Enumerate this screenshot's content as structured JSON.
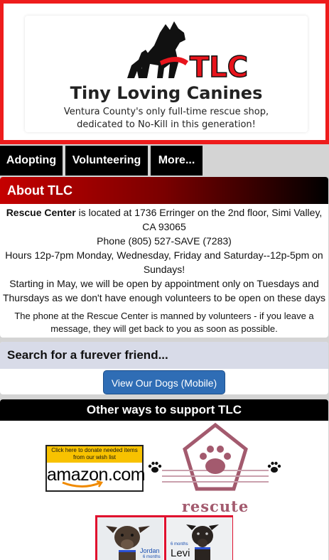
{
  "header": {
    "logo_text": "TLC",
    "title": "Tiny Loving Canines",
    "tagline_line1": "Ventura County's only full-time rescue shop,",
    "tagline_line2": "dedicated to No-Kill in this generation!"
  },
  "nav": [
    {
      "label": "Adopting"
    },
    {
      "label": "Volunteering"
    },
    {
      "label": "More..."
    }
  ],
  "about": {
    "heading": "About TLC",
    "rescue_center_bold": "Rescue Center",
    "location": " is located at 1736 Erringer on the 2nd floor, Simi Valley, CA 93065",
    "phone": "Phone (805) 527-SAVE (7283)",
    "hours": "Hours 12p-7pm Monday, Wednesday, Friday and Saturday--12p-5pm on Sundays!",
    "appointment": "Starting in May, we will be open by appointment only on Tuesdays and Thursdays as we don't have enough volunteers to be open on these days",
    "note": "The phone at the Rescue Center is manned by volunteers - if you leave a message, they will get back to you as soon as possible."
  },
  "search": {
    "heading": "Search for a furever friend...",
    "button": "View Our Dogs (Mobile)"
  },
  "support": {
    "heading": "Other ways to support TLC",
    "amazon_banner": "Click here to donate needed items from our wish list",
    "amazon_word": "amazon.com",
    "rescute_label": "rescute",
    "dogs": [
      {
        "name": "Jordan",
        "age": "6 months"
      },
      {
        "name": "Levi",
        "age": "6 months"
      }
    ]
  },
  "colors": {
    "header_border": "#ee1c1c",
    "about_gradient_start": "#c50000",
    "button_blue": "#2f6db5",
    "rescute_pink": "#a35a6e",
    "tlc_red": "#e8141c"
  }
}
